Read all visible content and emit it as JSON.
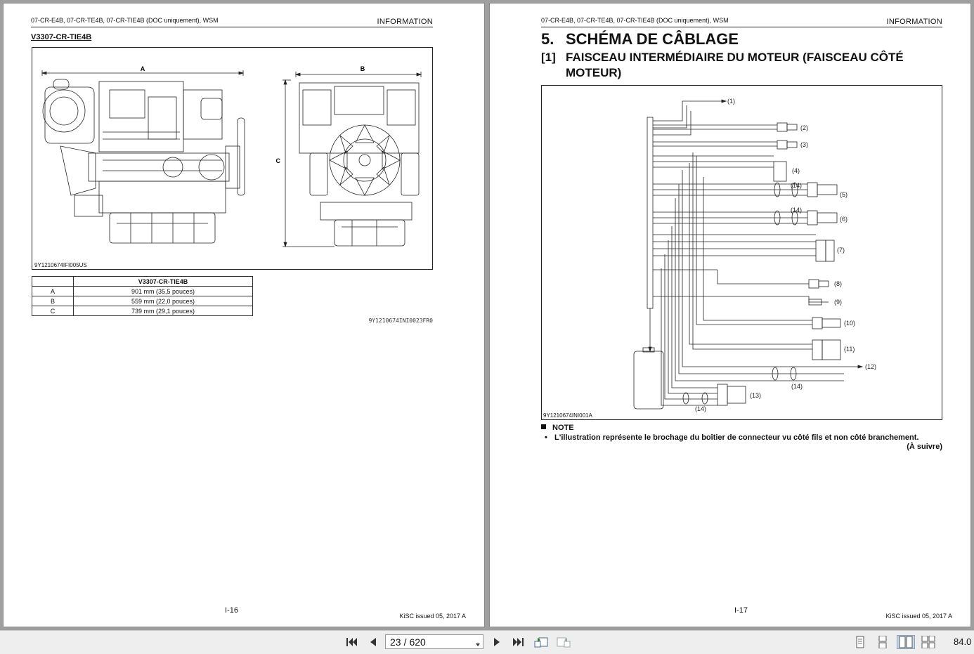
{
  "viewer": {
    "current_page": "23",
    "page_separator": "/",
    "total_pages": "620",
    "zoom": "84.0"
  },
  "left_page": {
    "header_doc": "07-CR-E4B, 07-CR-TE4B, 07-CR-TIE4B (DOC uniquement), WSM",
    "header_section": "INFORMATION",
    "model_title": "V3307-CR-TIE4B",
    "figure": {
      "labels": {
        "a": "A",
        "b": "B",
        "c": "C"
      },
      "id": "9Y1210674IFI005US"
    },
    "table": {
      "header": [
        "",
        "V3307-CR-TIE4B"
      ],
      "rows": [
        [
          "A",
          "901 mm (35,5 pouces)"
        ],
        [
          "B",
          "559 mm (22,0 pouces)"
        ],
        [
          "C",
          "739 mm (29,1 pouces)"
        ]
      ]
    },
    "ref_code": "9Y1210674INI0023FR0",
    "page_number": "I-16",
    "issued": "KiSC issued 05, 2017 A"
  },
  "right_page": {
    "header_doc": "07-CR-E4B, 07-CR-TE4B, 07-CR-TIE4B (DOC uniquement), WSM",
    "header_section": "INFORMATION",
    "section_number": "5.",
    "section_title": "SCHÉMA DE CÂBLAGE",
    "subsection_number": "[1]",
    "subsection_title": "FAISCEAU INTERMÉDIAIRE DU MOTEUR (FAISCEAU CÔTÉ MOTEUR)",
    "diagram": {
      "callouts": [
        "(1)",
        "(2)",
        "(3)",
        "(4)",
        "(5)",
        "(6)",
        "(7)",
        "(8)",
        "(9)",
        "(10)",
        "(11)",
        "(12)",
        "(13)",
        "(14)"
      ],
      "id": "9Y1210674INI001A"
    },
    "note_title": "NOTE",
    "note_bullet": "•",
    "note_text": "L'illustration représente le brochage du boîtier de connecteur vu côté fils et non côté branchement.",
    "continued": "(À suivre)",
    "page_number": "I-17",
    "issued": "KiSC issued 05, 2017 A"
  },
  "icons": {
    "first": "first-page-icon",
    "prev": "previous-page-icon",
    "next": "next-page-icon",
    "last": "last-page-icon",
    "back": "previous-view-icon",
    "forward": "next-view-icon",
    "single": "single-page-view-icon",
    "continuous": "continuous-view-icon",
    "facing": "facing-view-icon",
    "facing_continuous": "continuous-facing-view-icon"
  },
  "colors": {
    "background": "#9f9f9f",
    "toolbar": "#eeeeee",
    "active_view": "#c9d6e6"
  }
}
